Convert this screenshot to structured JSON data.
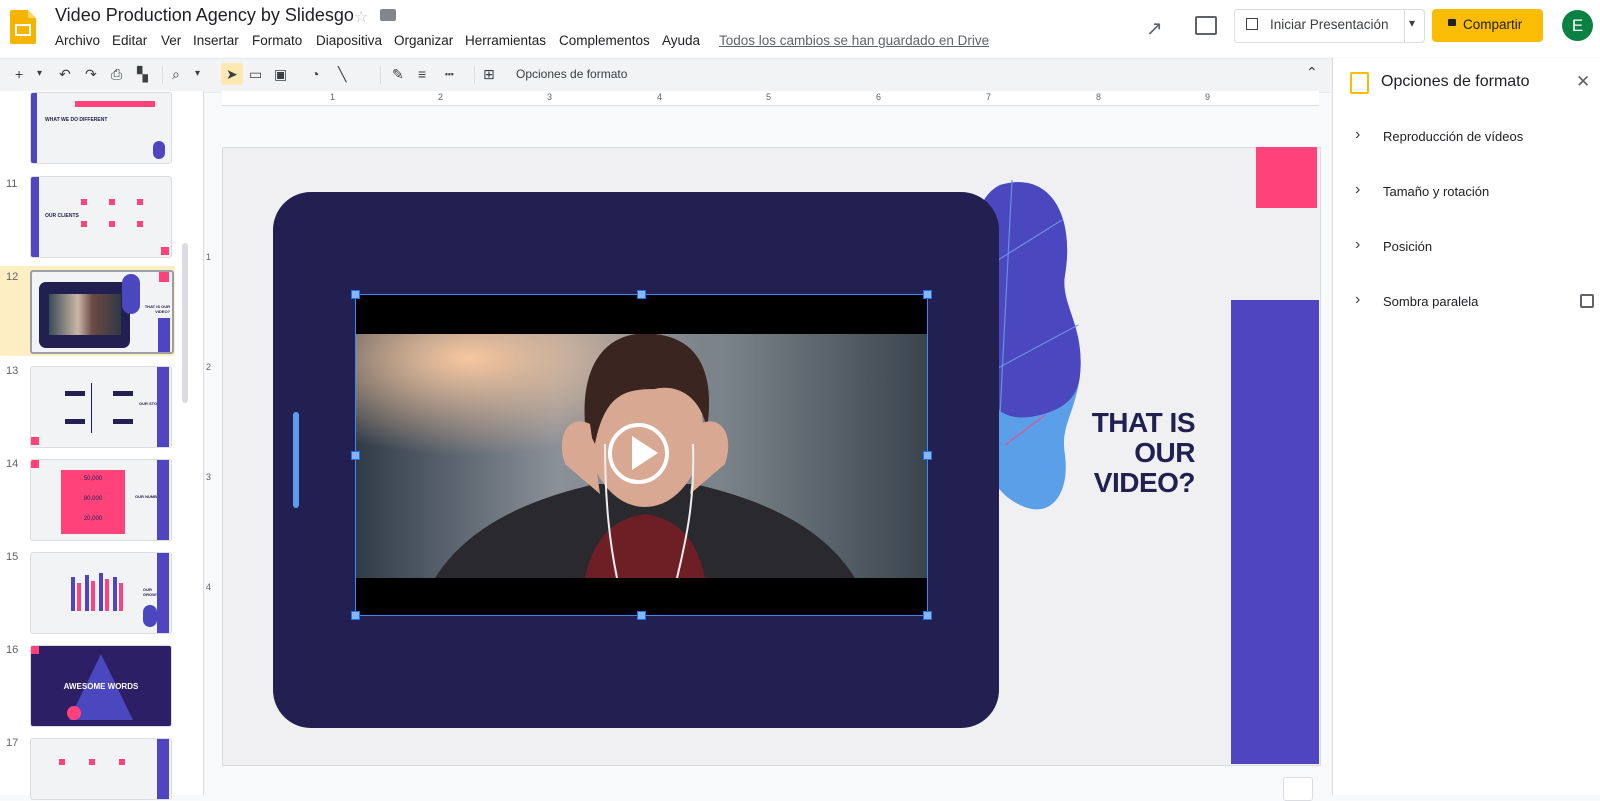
{
  "app": {
    "title": "Video Production Agency by Slidesgo",
    "menu": [
      "Archivo",
      "Editar",
      "Ver",
      "Insertar",
      "Formato",
      "Diapositiva",
      "Organizar",
      "Herramientas",
      "Complementos",
      "Ayuda"
    ],
    "save_status": "Todos los cambios se han guardado en Drive",
    "present_label": "Iniciar Presentación",
    "share_label": "Compartir",
    "avatar_letter": "E",
    "colors": {
      "share": "#fbbc04",
      "avatar": "#0b8043",
      "accent": "#4285f4"
    }
  },
  "toolbar": {
    "format_options": "Opciones de formato"
  },
  "filmstrip": {
    "slides": [
      {
        "num": "",
        "text": "WHAT WE DO DIFFERENT"
      },
      {
        "num": "11",
        "text": "OUR CLIENTS"
      },
      {
        "num": "12",
        "text": "THAT IS OUR VIDEO?"
      },
      {
        "num": "13",
        "text": "OUR STORY"
      },
      {
        "num": "14",
        "text": "OUR NUMBERS",
        "values": [
          "50,000",
          "80,000",
          "20,000"
        ]
      },
      {
        "num": "15",
        "text": "OUR GROWTH"
      },
      {
        "num": "16",
        "text": "AWESOME WORDS"
      },
      {
        "num": "17",
        "text": ""
      }
    ],
    "selected": "12"
  },
  "ruler": {
    "h": [
      "1",
      "2",
      "3",
      "4",
      "5",
      "6",
      "7",
      "8",
      "9"
    ],
    "v": [
      "1",
      "2",
      "3",
      "4"
    ]
  },
  "slide": {
    "heading": "THAT IS OUR VIDEO?",
    "colors": {
      "frame": "#212050",
      "pink": "#ff437a",
      "purple": "#5045c0",
      "blob": "#4a47bf",
      "blob_light": "#5a9fe8"
    }
  },
  "side_panel": {
    "title": "Opciones de formato",
    "sections": [
      "Reproducción de vídeos",
      "Tamaño y rotación",
      "Posición",
      "Sombra paralela"
    ],
    "shadow_checked": false
  }
}
